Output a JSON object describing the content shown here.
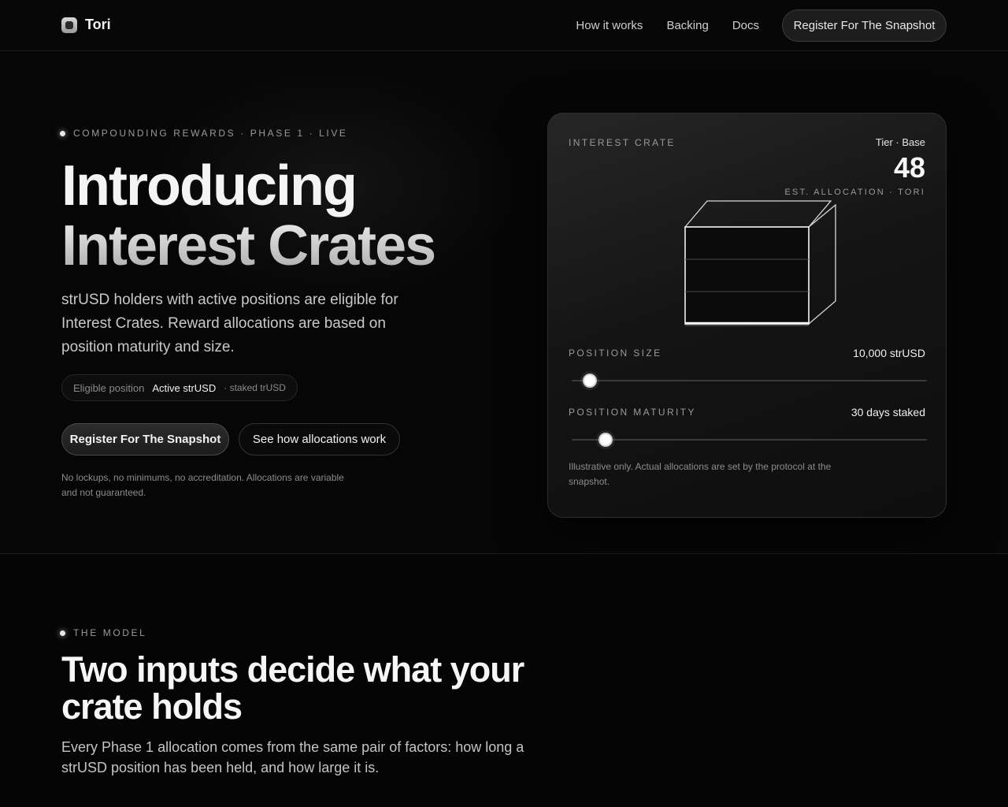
{
  "nav": {
    "brand": "Tori",
    "links": [
      "How it works",
      "Backing",
      "Docs"
    ],
    "cta": "Register For The Snapshot"
  },
  "hero": {
    "eyebrow": "COMPOUNDING REWARDS · PHASE 1 · LIVE",
    "title_line1": "Introducing",
    "title_line2": "Interest Crates",
    "subtitle": "strUSD holders with active positions are eligible for Interest Crates. Reward allocations are based on position maturity and size.",
    "pill": {
      "key": "Eligible position",
      "value": "Active strUSD",
      "suffix": "· staked trUSD"
    },
    "primary_button": "Register For The Snapshot",
    "secondary_button": "See how allocations work",
    "fine_print": "No lockups, no minimums, no accreditation. Allocations are variable and not guaranteed."
  },
  "card": {
    "label": "INTEREST CRATE",
    "tier": "Tier · Base",
    "value": "48",
    "allocation_label": "EST. ALLOCATION · TORI",
    "position_size": {
      "label": "POSITION SIZE",
      "value": "10,000 strUSD",
      "slider_fraction": 0.05
    },
    "position_maturity": {
      "label": "POSITION MATURITY",
      "value": "30 days staked",
      "slider_fraction": 0.095
    },
    "note": "Illustrative only. Actual allocations are set by the protocol at the snapshot."
  },
  "model": {
    "eyebrow": "THE MODEL",
    "title": "Two inputs decide what your crate holds",
    "subtitle": "Every Phase 1 allocation comes from the same pair of factors: how long a strUSD position has been held, and how large it is."
  },
  "colors": {
    "background": "#060606",
    "text": "#f4f4f4",
    "muted": "#9a9a9a"
  }
}
